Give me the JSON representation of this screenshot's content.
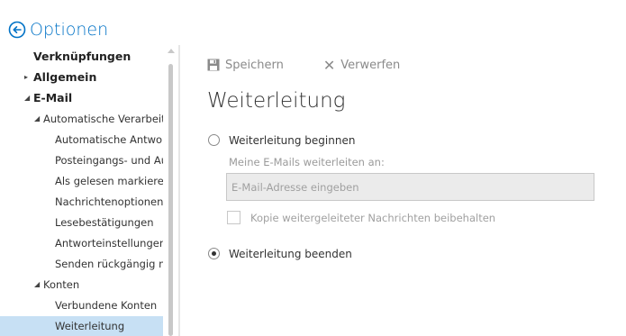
{
  "header": {
    "title": "Optionen",
    "back_icon": "back-arrow-circle-icon",
    "accent": "#0072c6"
  },
  "sidebar": {
    "items": [
      {
        "label": "Verknüpfungen",
        "level": 1,
        "expander": ""
      },
      {
        "label": "Allgemein",
        "level": 1,
        "expander": "▸"
      },
      {
        "label": "E-Mail",
        "level": 1,
        "expander": "◢"
      },
      {
        "label": "Automatische Verarbeitung",
        "level": 2,
        "expander": "◢"
      },
      {
        "label": "Automatische Antworten",
        "level": 3,
        "expander": ""
      },
      {
        "label": "Posteingangs- und Aufräumregeln",
        "level": 3,
        "expander": ""
      },
      {
        "label": "Als gelesen markieren",
        "level": 3,
        "expander": ""
      },
      {
        "label": "Nachrichtenoptionen",
        "level": 3,
        "expander": ""
      },
      {
        "label": "Lesebestätigungen",
        "level": 3,
        "expander": ""
      },
      {
        "label": "Antworteinstellungen",
        "level": 3,
        "expander": ""
      },
      {
        "label": "Senden rückgängig machen",
        "level": 3,
        "expander": ""
      },
      {
        "label": "Konten",
        "level": 2,
        "expander": "◢"
      },
      {
        "label": "Verbundene Konten",
        "level": 3,
        "expander": ""
      },
      {
        "label": "Weiterleitung",
        "level": 3,
        "expander": "",
        "selected": true
      }
    ],
    "selected_color": "#c7e0f4"
  },
  "toolbar": {
    "save_label": "Speichern",
    "discard_label": "Verwerfen",
    "discard_glyph": "✕"
  },
  "main": {
    "title": "Weiterleitung",
    "start_option": {
      "label": "Weiterleitung beginnen",
      "checked": false
    },
    "forward_to_label": "Meine E-Mails weiterleiten an:",
    "email_input": {
      "value": "",
      "placeholder": "E-Mail-Adresse eingeben"
    },
    "keep_copy": {
      "label": "Kopie weitergeleiteter Nachrichten beibehalten",
      "checked": false
    },
    "stop_option": {
      "label": "Weiterleitung beenden",
      "checked": true
    }
  }
}
